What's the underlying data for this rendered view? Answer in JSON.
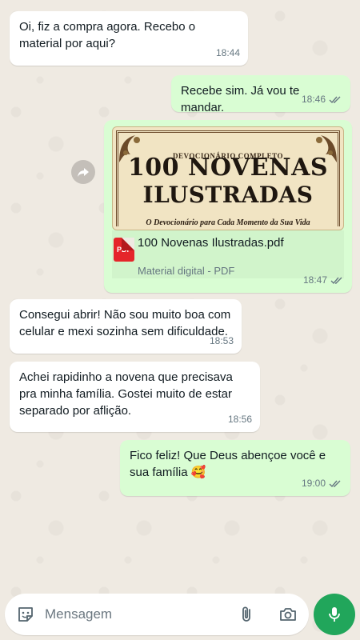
{
  "messages": [
    {
      "id": "m1",
      "direction": "in",
      "text": "Oi, fiz a compra agora. Recebo o material por aqui?",
      "time": "18:44"
    },
    {
      "id": "m2",
      "direction": "out",
      "text": "Recebe sim. Já vou te mandar.",
      "time": "18:46",
      "status": "read"
    },
    {
      "id": "m3",
      "direction": "out",
      "type": "document",
      "preview": {
        "kicker": "DEVOCIONÁRIO COMPLETO",
        "title_line1": "100 NOVENAS",
        "title_line2": "ILUSTRADAS",
        "subtitle": "O Devocionário para Cada Momento da Sua Vida"
      },
      "file_name": "100 Novenas Ilustradas.pdf",
      "file_badge": "PDF",
      "file_description": "Material digital - PDF",
      "time": "18:47",
      "status": "read"
    },
    {
      "id": "m4",
      "direction": "in",
      "text": "Consegui abrir! Não sou muito boa com celular e mexi sozinha sem dificuldade.",
      "time": "18:53"
    },
    {
      "id": "m5",
      "direction": "in",
      "text": "Achei rapidinho a novena que precisava pra minha família. Gostei muito de estar separado por aflição.",
      "time": "18:56"
    },
    {
      "id": "m6",
      "direction": "out",
      "text": "Fico feliz! Que Deus abençoe você e sua família 🥰",
      "time": "19:00",
      "status": "read"
    }
  ],
  "composer": {
    "placeholder": "Mensagem",
    "icons": {
      "sticker": "sticker-icon",
      "attach": "paperclip-icon",
      "camera": "camera-icon",
      "mic": "mic-icon"
    }
  },
  "colors": {
    "incoming_bubble": "#ffffff",
    "outgoing_bubble": "#d9fdd3",
    "chat_background": "#efeae2",
    "mic_button": "#21a65b",
    "meta_text": "#667781"
  }
}
